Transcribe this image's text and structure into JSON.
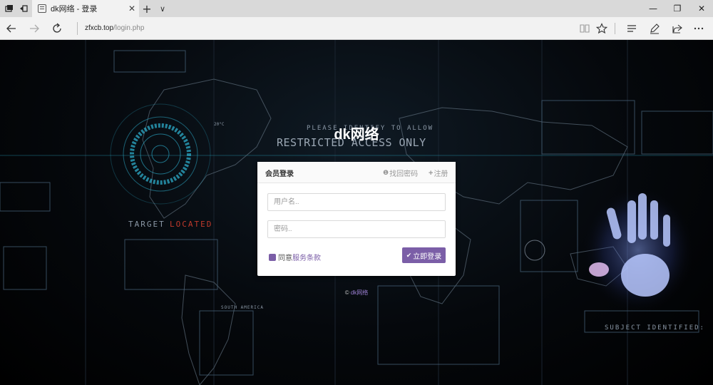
{
  "browser": {
    "tab_title": "dk网络 - 登录",
    "tab_close": "✕",
    "new_tab": "+",
    "tab_list": "∨",
    "url_host": "zfxcb.top",
    "url_path": "/login.php",
    "minimize": "—",
    "restore": "❐",
    "close": "✕"
  },
  "background": {
    "banner_line1": "PLEASE IDENTIFY TO ALLOW",
    "banner_line2": "RESTRICTED ACCESS ONLY",
    "target_label": "TARGET",
    "located_label": "LOCATED",
    "subject_label": "SUBJECT IDENTIFIED:",
    "temp_label": "20°C",
    "south_america": "SOUTH AMERICA",
    "accent_color": "#2fb6d6"
  },
  "site_title": "dk网络",
  "login": {
    "title": "会员登录",
    "forgot_label": "找回密码",
    "register_label": "注册",
    "username_placeholder": "用户名..",
    "password_placeholder": "密码..",
    "agree_label": "同意",
    "terms_label": "服务条款",
    "submit_label": "立即登录",
    "accent_color": "#7b5ea7"
  },
  "footer": {
    "copyright_symbol": "©",
    "brand": "dk网络"
  }
}
